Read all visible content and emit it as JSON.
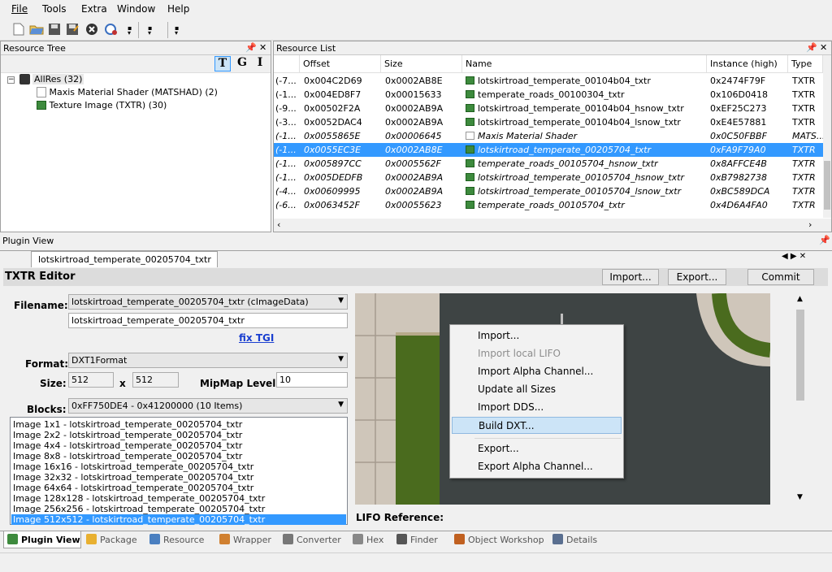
{
  "menu": [
    "File",
    "Tools",
    "Extra",
    "Window",
    "Help"
  ],
  "resource_tree": {
    "title": "Resource Tree",
    "modes": [
      "T",
      "G",
      "I"
    ],
    "root": "AllRes (32)",
    "children": [
      "Maxis Material Shader (MATSHAD) (2)",
      "Texture Image (TXTR) (30)"
    ]
  },
  "resource_list": {
    "title": "Resource List",
    "columns": [
      "Offset",
      "Size",
      "Name",
      "Instance (high)",
      "Type"
    ],
    "rows": [
      {
        "pre": "(-7...",
        "offset": "0x004C2D69",
        "size": "0x0002AB8E",
        "name": "lotskirtroad_temperate_00104b04_txtr",
        "instance": "0x2474F79F",
        "type": "TXTR",
        "italic": false,
        "selected": false,
        "icon": "image"
      },
      {
        "pre": "(-1...",
        "offset": "0x004ED8F7",
        "size": "0x00015633",
        "name": "temperate_roads_00100304_txtr",
        "instance": "0x106D0418",
        "type": "TXTR",
        "italic": false,
        "selected": false,
        "icon": "image"
      },
      {
        "pre": "(-9...",
        "offset": "0x00502F2A",
        "size": "0x0002AB9A",
        "name": "lotskirtroad_temperate_00104b04_hsnow_txtr",
        "instance": "0xEF25C273",
        "type": "TXTR",
        "italic": false,
        "selected": false,
        "icon": "image"
      },
      {
        "pre": "(-3...",
        "offset": "0x0052DAC4",
        "size": "0x0002AB9A",
        "name": "lotskirtroad_temperate_00104b04_lsnow_txtr",
        "instance": "0xE4E57881",
        "type": "TXTR",
        "italic": false,
        "selected": false,
        "icon": "image"
      },
      {
        "pre": "(-1...",
        "offset": "0x0055865E",
        "size": "0x00006645",
        "name": "Maxis Material Shader",
        "instance": "0x0C50FBBF",
        "type": "MATS...",
        "italic": true,
        "selected": false,
        "icon": "doc"
      },
      {
        "pre": "(-1...",
        "offset": "0x0055EC3E",
        "size": "0x0002AB8E",
        "name": "lotskirtroad_temperate_00205704_txtr",
        "instance": "0xFA9F79A0",
        "type": "TXTR",
        "italic": true,
        "selected": true,
        "icon": "image"
      },
      {
        "pre": "(-1...",
        "offset": "0x005897CC",
        "size": "0x0005562F",
        "name": "temperate_roads_00105704_hsnow_txtr",
        "instance": "0x8AFFCE4B",
        "type": "TXTR",
        "italic": true,
        "selected": false,
        "icon": "image"
      },
      {
        "pre": "(-1...",
        "offset": "0x005DEDFB",
        "size": "0x0002AB9A",
        "name": "lotskirtroad_temperate_00105704_hsnow_txtr",
        "instance": "0xB7982738",
        "type": "TXTR",
        "italic": true,
        "selected": false,
        "icon": "image"
      },
      {
        "pre": "(-4...",
        "offset": "0x00609995",
        "size": "0x0002AB9A",
        "name": "lotskirtroad_temperate_00105704_lsnow_txtr",
        "instance": "0xBC589DCA",
        "type": "TXTR",
        "italic": true,
        "selected": false,
        "icon": "image"
      },
      {
        "pre": "(-6...",
        "offset": "0x0063452F",
        "size": "0x00055623",
        "name": "temperate_roads_00105704_txtr",
        "instance": "0x4D6A4FA0",
        "type": "TXTR",
        "italic": true,
        "selected": false,
        "icon": "image"
      }
    ]
  },
  "plugin_view": {
    "title": "Plugin View",
    "doc_tab": "lotskirtroad_temperate_00205704_txtr",
    "editor_title": "TXTR Editor",
    "buttons": {
      "import": "Import...",
      "export": "Export...",
      "commit": "Commit"
    },
    "filename_label": "Filename:",
    "filename_combo": "lotskirtroad_temperate_00205704_txtr (cImageData)",
    "filename_text": "lotskirtroad_temperate_00205704_txtr",
    "fix_tgi": "fix TGI",
    "format_label": "Format:",
    "format_value": "DXT1Format",
    "size_label": "Size:",
    "size_w": "512",
    "size_x": "x",
    "size_h": "512",
    "mipmap_label": "MipMap Level:",
    "mipmap_value": "10",
    "blocks_label": "Blocks:",
    "blocks_value": "0xFF750DE4 - 0x41200000 (10 Items)",
    "blocks": [
      "Image 1x1 - lotskirtroad_temperate_00205704_txtr",
      "Image 2x2 - lotskirtroad_temperate_00205704_txtr",
      "Image 4x4 - lotskirtroad_temperate_00205704_txtr",
      "Image 8x8 - lotskirtroad_temperate_00205704_txtr",
      "Image 16x16 - lotskirtroad_temperate_00205704_txtr",
      "Image 32x32 - lotskirtroad_temperate_00205704_txtr",
      "Image 64x64 - lotskirtroad_temperate_00205704_txtr",
      "Image 128x128 - lotskirtroad_temperate_00205704_txtr",
      "Image 256x256 - lotskirtroad_temperate_00205704_txtr",
      "Image 512x512 - lotskirtroad_temperate_00205704_txtr"
    ],
    "selected_block": 9,
    "lifo_label": "LIFO Reference:"
  },
  "context_menu": {
    "items": [
      "Import...",
      "Import local  LIFO",
      "Import Alpha Channel...",
      "Update all Sizes",
      "Import DDS...",
      "Build DXT...",
      "Export...",
      "Export Alpha Channel..."
    ],
    "disabled_index": 1,
    "highlight_index": 5
  },
  "bottom_tabs": [
    "Plugin View",
    "Package",
    "Resource",
    "Wrapper",
    "Converter",
    "Hex",
    "Finder",
    "Object Workshop",
    "Details"
  ],
  "colors": {
    "selection": "#3399ff",
    "road": "#3e4444",
    "grass": "#4a6b1e",
    "tile": "#d8cfc4"
  }
}
